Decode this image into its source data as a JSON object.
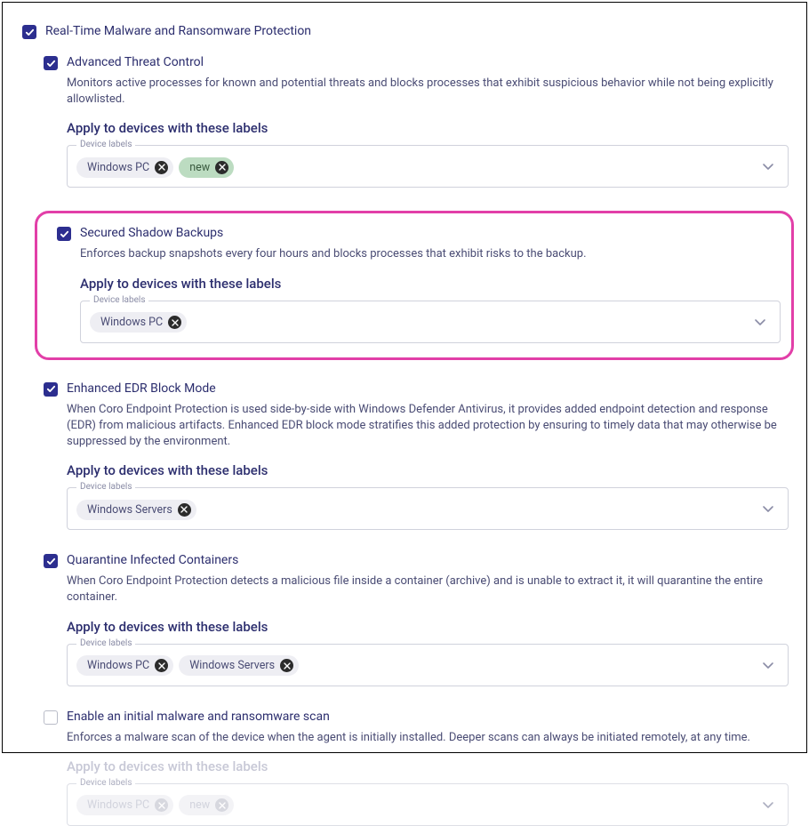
{
  "main": {
    "title": "Real-Time Malware and Ransomware Protection"
  },
  "fieldLegend": "Device labels",
  "applyLabel": "Apply to devices with these labels",
  "sections": {
    "atc": {
      "title": "Advanced Threat Control",
      "desc": "Monitors active processes for known and potential threats and blocks processes that exhibit suspicious behavior while not being explicitly allowlisted.",
      "chips": [
        {
          "label": "Windows PC",
          "variant": "grey"
        },
        {
          "label": "new",
          "variant": "green"
        }
      ]
    },
    "ssb": {
      "title": "Secured Shadow Backups",
      "desc": "Enforces backup snapshots every four hours and blocks processes that exhibit risks to the backup.",
      "chips": [
        {
          "label": "Windows PC",
          "variant": "grey"
        }
      ]
    },
    "edr": {
      "title": "Enhanced EDR Block Mode",
      "desc": "When Coro Endpoint Protection is used side-by-side with Windows Defender Antivirus, it provides added endpoint detection and response (EDR) from malicious artifacts. Enhanced EDR block mode stratifies this added protection by ensuring to timely data that may otherwise be suppressed by the environment.",
      "chips": [
        {
          "label": "Windows Servers",
          "variant": "grey"
        }
      ]
    },
    "qic": {
      "title": "Quarantine Infected Containers",
      "desc": "When Coro Endpoint Protection detects a malicious file inside a container (archive) and is unable to extract it, it will quarantine the entire container.",
      "chips": [
        {
          "label": "Windows PC",
          "variant": "grey"
        },
        {
          "label": "Windows Servers",
          "variant": "grey"
        }
      ]
    },
    "initial": {
      "title": "Enable an initial malware and ransomware scan",
      "desc": "Enforces a malware scan of the device when the agent is initially installed. Deeper scans can always be initiated remotely, at any time.",
      "chips": [
        {
          "label": "Windows PC",
          "variant": "grey"
        },
        {
          "label": "new",
          "variant": "grey"
        }
      ]
    }
  }
}
